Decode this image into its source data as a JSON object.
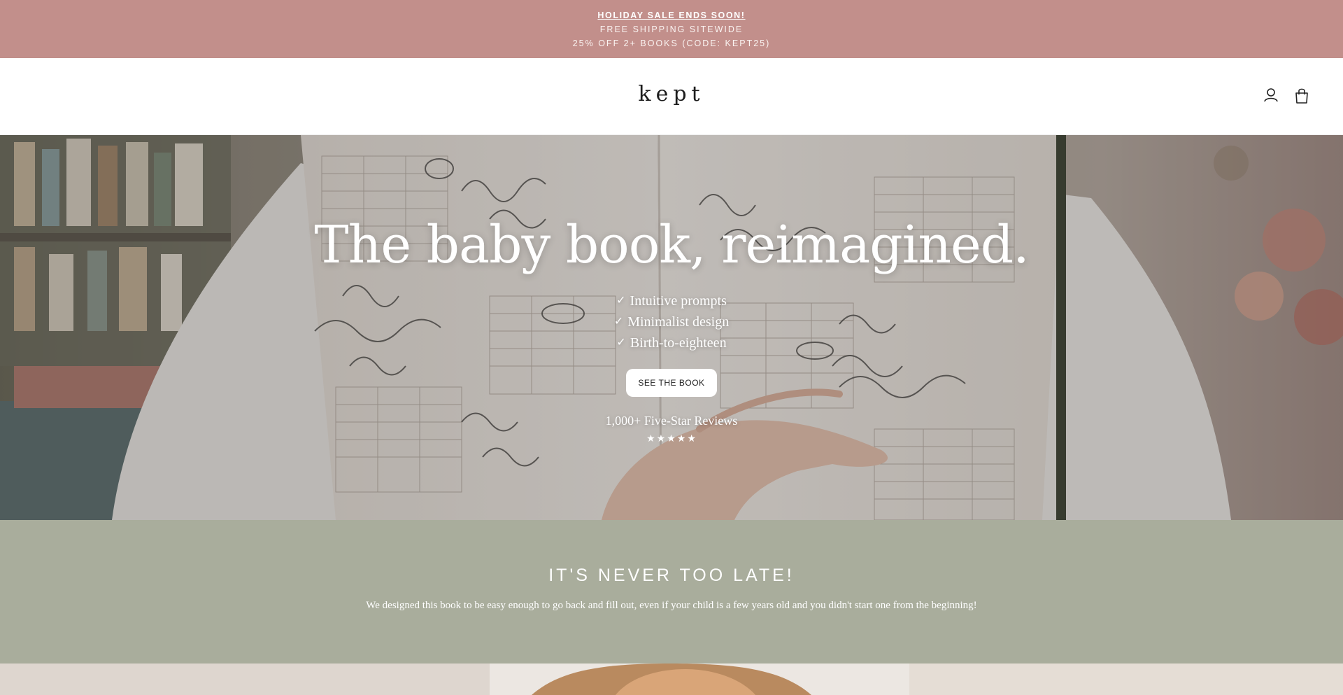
{
  "announcement": {
    "sale": "HOLIDAY SALE ENDS SOON!",
    "shipping": "FREE SHIPPING SITEWIDE",
    "promo": "25% OFF 2+ BOOKS (CODE: KEPT25)"
  },
  "header": {
    "logo": "kept",
    "icons": [
      "account-icon",
      "cart-icon"
    ]
  },
  "hero": {
    "title": "The baby book, reimagined.",
    "features": [
      {
        "icon": "check-icon",
        "text": "Intuitive prompts"
      },
      {
        "icon": "check-icon",
        "text": "Minimalist design"
      },
      {
        "icon": "check-icon",
        "text": "Birth-to-eighteen"
      }
    ],
    "cta_label": "SEE THE BOOK",
    "reviews": "1,000+ Five-Star Reviews",
    "rating": 5
  },
  "band": {
    "title": "IT'S NEVER TOO LATE!",
    "text": "We designed this book to be easy enough to go back and fill out, even if your child is a few years old and you didn't start one from the beginning!"
  },
  "colors": {
    "announcement_bg": "#c28f8b",
    "band_bg": "#a9ad9c",
    "cta_bg": "#ffffff"
  }
}
